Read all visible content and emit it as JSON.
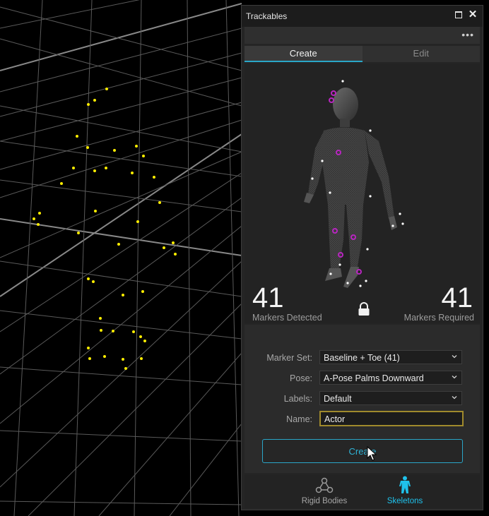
{
  "panel": {
    "title": "Trackables",
    "tabs": [
      {
        "label": "Create",
        "active": true
      },
      {
        "label": "Edit",
        "active": false
      }
    ],
    "markers_detected": {
      "value": "41",
      "label": "Markers Detected"
    },
    "markers_required": {
      "value": "41",
      "label": "Markers Required"
    },
    "form": {
      "marker_set": {
        "label": "Marker Set:",
        "value": "Baseline + Toe (41)"
      },
      "pose": {
        "label": "Pose:",
        "value": "A-Pose Palms Downward"
      },
      "labels": {
        "label": "Labels:",
        "value": "Default"
      },
      "name": {
        "label": "Name:",
        "value": "Actor"
      }
    },
    "create_button": "Create",
    "bottom_tabs": [
      {
        "label": "Rigid Bodies",
        "icon": "rigid-body-icon",
        "active": false
      },
      {
        "label": "Skeletons",
        "icon": "skeleton-icon",
        "active": true
      }
    ],
    "accent_color": "#2aa6c8",
    "marker_color": "#b825c0"
  },
  "viewport": {
    "marker_color": "#ffee00",
    "grid_color": "#9a9a9a"
  }
}
